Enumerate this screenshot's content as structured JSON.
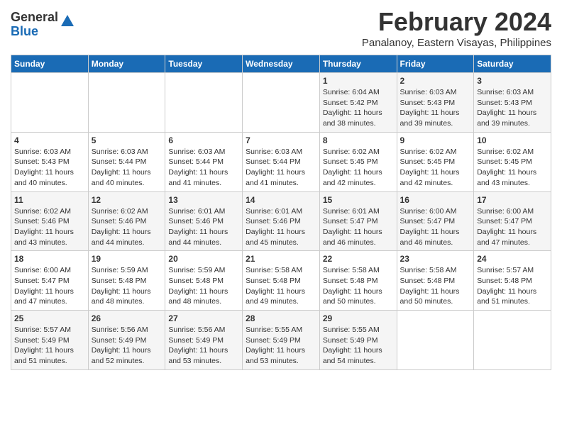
{
  "logo": {
    "general": "General",
    "blue": "Blue"
  },
  "title": "February 2024",
  "subtitle": "Panalanoy, Eastern Visayas, Philippines",
  "days_header": [
    "Sunday",
    "Monday",
    "Tuesday",
    "Wednesday",
    "Thursday",
    "Friday",
    "Saturday"
  ],
  "weeks": [
    [
      {
        "day": "",
        "info": ""
      },
      {
        "day": "",
        "info": ""
      },
      {
        "day": "",
        "info": ""
      },
      {
        "day": "",
        "info": ""
      },
      {
        "day": "1",
        "info": "Sunrise: 6:04 AM\nSunset: 5:42 PM\nDaylight: 11 hours\nand 38 minutes."
      },
      {
        "day": "2",
        "info": "Sunrise: 6:03 AM\nSunset: 5:43 PM\nDaylight: 11 hours\nand 39 minutes."
      },
      {
        "day": "3",
        "info": "Sunrise: 6:03 AM\nSunset: 5:43 PM\nDaylight: 11 hours\nand 39 minutes."
      }
    ],
    [
      {
        "day": "4",
        "info": "Sunrise: 6:03 AM\nSunset: 5:43 PM\nDaylight: 11 hours\nand 40 minutes."
      },
      {
        "day": "5",
        "info": "Sunrise: 6:03 AM\nSunset: 5:44 PM\nDaylight: 11 hours\nand 40 minutes."
      },
      {
        "day": "6",
        "info": "Sunrise: 6:03 AM\nSunset: 5:44 PM\nDaylight: 11 hours\nand 41 minutes."
      },
      {
        "day": "7",
        "info": "Sunrise: 6:03 AM\nSunset: 5:44 PM\nDaylight: 11 hours\nand 41 minutes."
      },
      {
        "day": "8",
        "info": "Sunrise: 6:02 AM\nSunset: 5:45 PM\nDaylight: 11 hours\nand 42 minutes."
      },
      {
        "day": "9",
        "info": "Sunrise: 6:02 AM\nSunset: 5:45 PM\nDaylight: 11 hours\nand 42 minutes."
      },
      {
        "day": "10",
        "info": "Sunrise: 6:02 AM\nSunset: 5:45 PM\nDaylight: 11 hours\nand 43 minutes."
      }
    ],
    [
      {
        "day": "11",
        "info": "Sunrise: 6:02 AM\nSunset: 5:46 PM\nDaylight: 11 hours\nand 43 minutes."
      },
      {
        "day": "12",
        "info": "Sunrise: 6:02 AM\nSunset: 5:46 PM\nDaylight: 11 hours\nand 44 minutes."
      },
      {
        "day": "13",
        "info": "Sunrise: 6:01 AM\nSunset: 5:46 PM\nDaylight: 11 hours\nand 44 minutes."
      },
      {
        "day": "14",
        "info": "Sunrise: 6:01 AM\nSunset: 5:46 PM\nDaylight: 11 hours\nand 45 minutes."
      },
      {
        "day": "15",
        "info": "Sunrise: 6:01 AM\nSunset: 5:47 PM\nDaylight: 11 hours\nand 46 minutes."
      },
      {
        "day": "16",
        "info": "Sunrise: 6:00 AM\nSunset: 5:47 PM\nDaylight: 11 hours\nand 46 minutes."
      },
      {
        "day": "17",
        "info": "Sunrise: 6:00 AM\nSunset: 5:47 PM\nDaylight: 11 hours\nand 47 minutes."
      }
    ],
    [
      {
        "day": "18",
        "info": "Sunrise: 6:00 AM\nSunset: 5:47 PM\nDaylight: 11 hours\nand 47 minutes."
      },
      {
        "day": "19",
        "info": "Sunrise: 5:59 AM\nSunset: 5:48 PM\nDaylight: 11 hours\nand 48 minutes."
      },
      {
        "day": "20",
        "info": "Sunrise: 5:59 AM\nSunset: 5:48 PM\nDaylight: 11 hours\nand 48 minutes."
      },
      {
        "day": "21",
        "info": "Sunrise: 5:58 AM\nSunset: 5:48 PM\nDaylight: 11 hours\nand 49 minutes."
      },
      {
        "day": "22",
        "info": "Sunrise: 5:58 AM\nSunset: 5:48 PM\nDaylight: 11 hours\nand 50 minutes."
      },
      {
        "day": "23",
        "info": "Sunrise: 5:58 AM\nSunset: 5:48 PM\nDaylight: 11 hours\nand 50 minutes."
      },
      {
        "day": "24",
        "info": "Sunrise: 5:57 AM\nSunset: 5:48 PM\nDaylight: 11 hours\nand 51 minutes."
      }
    ],
    [
      {
        "day": "25",
        "info": "Sunrise: 5:57 AM\nSunset: 5:49 PM\nDaylight: 11 hours\nand 51 minutes."
      },
      {
        "day": "26",
        "info": "Sunrise: 5:56 AM\nSunset: 5:49 PM\nDaylight: 11 hours\nand 52 minutes."
      },
      {
        "day": "27",
        "info": "Sunrise: 5:56 AM\nSunset: 5:49 PM\nDaylight: 11 hours\nand 53 minutes."
      },
      {
        "day": "28",
        "info": "Sunrise: 5:55 AM\nSunset: 5:49 PM\nDaylight: 11 hours\nand 53 minutes."
      },
      {
        "day": "29",
        "info": "Sunrise: 5:55 AM\nSunset: 5:49 PM\nDaylight: 11 hours\nand 54 minutes."
      },
      {
        "day": "",
        "info": ""
      },
      {
        "day": "",
        "info": ""
      }
    ]
  ]
}
